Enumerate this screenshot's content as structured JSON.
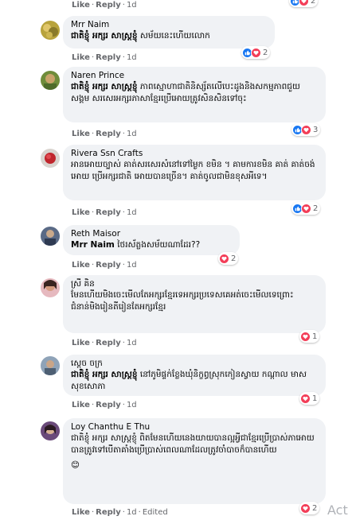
{
  "actions": {
    "like": "Like",
    "reply": "Reply",
    "dot": "·"
  },
  "comments": [
    {
      "time": "1d",
      "reactions": {
        "icons": [
          "like",
          "love"
        ],
        "count": "2"
      }
    },
    {
      "author": "Mrr Naim",
      "tag": "ជាតិខ្ញុំ អក្សរ សាស្ត្រខ្ញុំ",
      "text": " សម័យនេះហើយលោក",
      "time": "1d",
      "reactions": {
        "icons": [
          "like",
          "love"
        ],
        "count": "2"
      }
    },
    {
      "author": "Naren Prince",
      "tag": "ជាតិខ្ញុំ អក្សរ សាស្ត្រខ្ញុំ",
      "text": " ភាពស្មោហាជាតិនិស្ស័តលើបេះដូងនិងសកម្មភាពជួយសង្គម សរសេរអក្សរភាសាខ្មែរប្រើអោយត្រូវសិនសិនទៅចុះ",
      "time": "1d",
      "reactions": {
        "icons": [
          "like",
          "love"
        ],
        "count": "3"
      }
    },
    {
      "author": "Rivera Ssn Crafts",
      "text": "អានអោយច្បាស់ គាត់សរសេរសំនៅទៅម្ងៃក ខមិន ។ គាមការខមិន គាត់ គាត់ចង់អោយ ប្រើអក្សរជាតិ អោយបានច្រើន។ គាត់ចូលជាមិនខុសអីទេ។",
      "time": "1d",
      "reactions": {
        "icons": [
          "like",
          "love"
        ],
        "count": "2"
      }
    },
    {
      "author": "Reth Maisor",
      "tag": "Mrr Naim",
      "text": " ថៃរស័ត្លងសម័យណាដែរ??",
      "time": "1d",
      "reactions": {
        "icons": [
          "love"
        ],
        "count": "2"
      }
    },
    {
      "author": "ស្រី គិន",
      "text": "មែនហើយមិងចេះមើលតែអក្សរខ្មែរទេអក្សរប្រទេសគេអត់ចេះមើលទេព្រោះជំនាន់មិងរៀនតីរៀនតែអក្សរខ្មែរ",
      "time": "1d",
      "reactions": {
        "icons": [
          "love"
        ],
        "count": "1"
      }
    },
    {
      "author": "ស្ដេច ចក្រ",
      "tag": "ជាតិខ្ញុំ អក្សរ សាស្ត្រខ្ញុំ",
      "text": " នៅភូមិផ្ទក់ខ្លែងឃុំនិក្ខព្ធស្រុកកៀនស្វាយ កណ្ដាល មាស សុខសោភា",
      "time": "1d",
      "reactions": {
        "icons": [
          "love"
        ],
        "count": "1"
      }
    },
    {
      "author": "Loy Chanthu E Thu",
      "text": "ជាតិខ្ញុំ អក្សរ សាស្ត្រខ្ញុំ ពិតមែនហើយនេងយាយបានល្អអ្វីជាខ្មែរប្រើប្រាស់ភាអោយបានត្រូវទៅបើតាគាំងប្រើប្រាស់ពេលណាដែលត្រូវចាំបាចក៏បានហើយ",
      "emoji": "😊",
      "time": "1d",
      "edited": "Edited",
      "reactions": {
        "icons": [
          "love"
        ],
        "count": "2"
      }
    }
  ],
  "watermark": "Act",
  "colors": {
    "bubble": "#f0f2f5",
    "link_gray": "#65676b",
    "like_blue": "#1877f2",
    "love_red": "#f33e58"
  }
}
